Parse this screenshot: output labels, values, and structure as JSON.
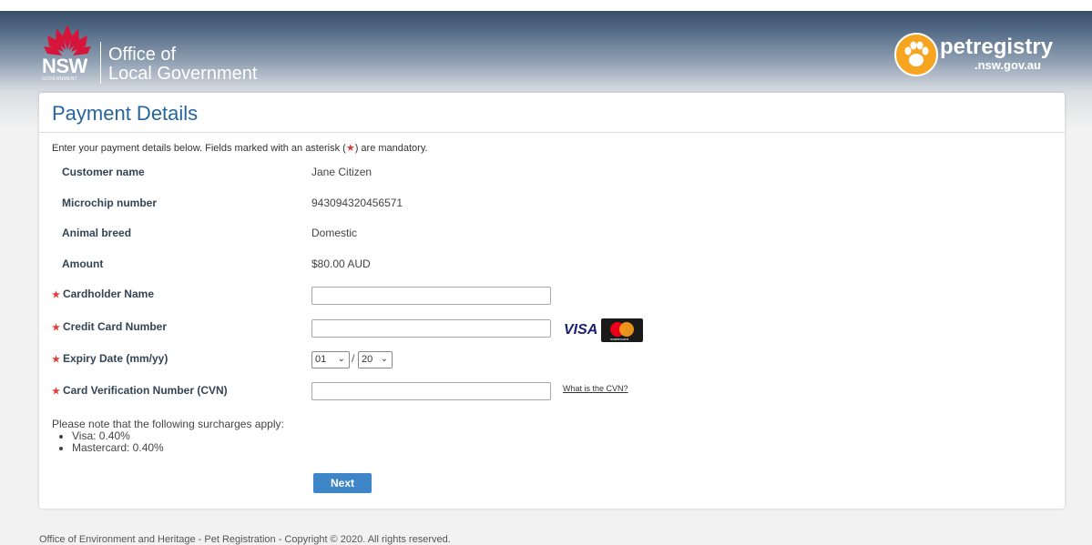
{
  "header": {
    "nsw_wordmark": "NSW",
    "nsw_government": "GOVERNMENT",
    "agency_line1": "Office of",
    "agency_line2": "Local Government",
    "pet_registry": "petregistry",
    "pet_registry_domain": ".nsw.gov.au",
    "icons": [
      "waratah-logo-icon",
      "paw-icon"
    ]
  },
  "page": {
    "title": "Payment Details",
    "intro_before": "Enter your payment details below. Fields marked with an asterisk (",
    "intro_star": "★",
    "intro_after": ") are mandatory."
  },
  "summary": [
    {
      "label": "Customer name",
      "value": "Jane Citizen"
    },
    {
      "label": "Microchip number",
      "value": "943094320456571"
    },
    {
      "label": "Animal breed",
      "value": "Domestic"
    },
    {
      "label": "Amount",
      "value": "$80.00 AUD"
    }
  ],
  "form": {
    "required_marker": "★",
    "cardholder_name": {
      "label": "Cardholder Name",
      "value": ""
    },
    "card_number": {
      "label": "Credit Card Number",
      "value": ""
    },
    "expiry": {
      "label": "Expiry Date (mm/yy)",
      "month": "01",
      "separator": "/",
      "year": "20"
    },
    "cvn": {
      "label": "Card Verification Number (CVN)",
      "value": "",
      "help_link": "What is the CVN?"
    },
    "card_brands": {
      "visa": "VISA",
      "mastercard": "mastercard"
    }
  },
  "surcharges": {
    "intro": "Please note that the following surcharges apply:",
    "items": [
      "Visa: 0.40%",
      "Mastercard: 0.40%"
    ]
  },
  "actions": {
    "next": "Next"
  },
  "footer": {
    "text": "Office of Environment and Heritage - Pet Registration - Copyright © 2020. All rights reserved."
  },
  "colors": {
    "accent": "#27659e",
    "button": "#3f86c8",
    "required": "#e03b37"
  }
}
